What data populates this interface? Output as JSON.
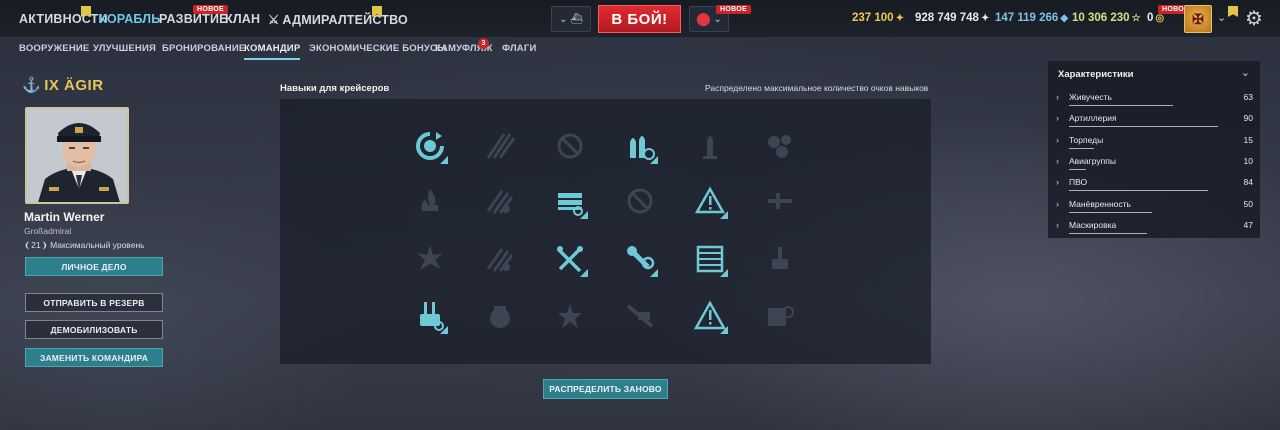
{
  "topbar": {
    "nav": [
      "АКТИВНОСТИ",
      "КОРАБЛЬ",
      "РАЗВИТИЕ",
      "КЛАН",
      "АДМИРАЛТЕЙСТВО"
    ],
    "new_badge": "НОВОЕ",
    "battle_label": "В БОЙ!",
    "currencies": {
      "credits": "237 100",
      "silver": "928 749 748",
      "free_xp": "147 119 266",
      "elite_xp": "10 306 230",
      "other": "0"
    }
  },
  "subtabs": [
    "ВООРУЖЕНИЕ",
    "УЛУЧШЕНИЯ",
    "БРОНИРОВАНИЕ",
    "КОМАНДИР",
    "ЭКОНОМИЧЕСКИЕ БОНУСЫ",
    "КАМУФЛЯЖ",
    "ФЛАГИ"
  ],
  "camo_count": "3",
  "ship": {
    "title": "IX ÄGIR"
  },
  "commander": {
    "name": "Martin Werner",
    "rank": "Großadmiral",
    "level": "21",
    "level_text": "Максимальный уровень"
  },
  "buttons": {
    "personal_file": "ЛИЧНОЕ ДЕЛО",
    "reserve": "ОТПРАВИТЬ В РЕЗЕРВ",
    "demobilize": "ДЕМОБИЛИЗОВАТЬ",
    "replace": "ЗАМЕНИТЬ КОМАНДИРА",
    "redistribute": "РАСПРЕДЕЛИТЬ ЗАНОВО"
  },
  "skills": {
    "title": "Навыки для крейсеров",
    "status": "Распределено максимальное количество очков навыков",
    "grid": [
      [
        1,
        0,
        0,
        1,
        0,
        0
      ],
      [
        0,
        0,
        1,
        0,
        1,
        0
      ],
      [
        0,
        0,
        1,
        1,
        1,
        0
      ],
      [
        1,
        0,
        0,
        0,
        1,
        0
      ]
    ]
  },
  "characteristics": {
    "title": "Характеристики",
    "items": [
      {
        "label": "Живучесть",
        "value": "63",
        "level": 0.63
      },
      {
        "label": "Артиллерия",
        "value": "90",
        "level": 0.9
      },
      {
        "label": "Торпеды",
        "value": "15",
        "level": 0.15
      },
      {
        "label": "Авиагруппы",
        "value": "10",
        "level": 0.1
      },
      {
        "label": "ПВО",
        "value": "84",
        "level": 0.84
      },
      {
        "label": "Манёвренность",
        "value": "50",
        "level": 0.5
      },
      {
        "label": "Маскировка",
        "value": "47",
        "level": 0.47
      }
    ]
  }
}
